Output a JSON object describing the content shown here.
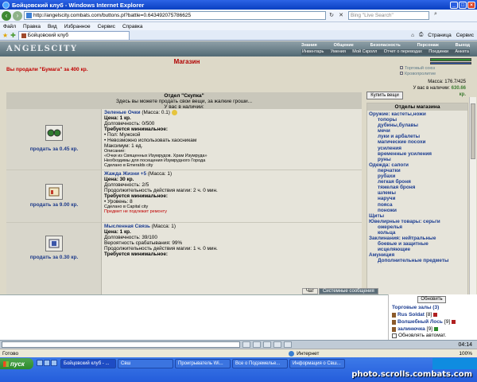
{
  "window": {
    "title": "Бойцовский клуб - Windows Internet Explorer",
    "address": "http://angelscity.combats.com/buttons.pl?battle=0.643492075786625",
    "search_placeholder": "Bing \"Live Search\""
  },
  "menu": [
    "Файл",
    "Правка",
    "Вид",
    "Избранное",
    "Сервис",
    "Справка"
  ],
  "tab_title": "Бойцовский клуб",
  "toolbar": {
    "page": "Страница",
    "service": "Сервис"
  },
  "site": {
    "logo": "ANGELSCITY",
    "nav_top": [
      "Знания",
      "Общение",
      "Безопасность",
      "Персонаж",
      "Выход"
    ],
    "nav_bottom": [
      "Инвентарь",
      "Умения",
      "Мой Скролл",
      "Отчет о переводах",
      "Поединки",
      "Анкета"
    ]
  },
  "shop": {
    "title": "Магазин",
    "sold_message": "Вы продали \"Бумага\" за 400 кр.",
    "effects": [
      "Торговый союз",
      "Кровопролитие"
    ],
    "mass": "Масса: 176.7/425",
    "money_label": "У вас в наличии:",
    "money_value": "630.66 кр.",
    "panel": {
      "title": "Отдел \"Скупка\"",
      "subtitle": "Здесь вы можете продать свои вещи, за жалкие гроши...",
      "in_stock": "У вас в наличии:"
    },
    "items": [
      {
        "sell": "продать за 0.45 кр.",
        "name": "Зеленые Очки",
        "mass": "(Масса: 0.1)",
        "price": "Цена: 1 кр.",
        "durability": "Долговечность: 0/500",
        "req_title": "Требуется минимальное:",
        "reqs": [
          "• Пол: Мужской",
          "• Невозможно использовать хаосникам"
        ],
        "extra": "Максимум: 1 ед.",
        "desc_title": "Описание:",
        "desc": "«Очки из Священных Изумрудов. Храм Изумруда»",
        "note": "Необходимы для посещения Изумрудного Города",
        "made": "Сделано в Emeralds city",
        "warn": ""
      },
      {
        "sell": "продать за 9.00 кр.",
        "name": "Жажда Жизни +5",
        "mass": "(Масса: 1)",
        "price": "Цена: 30 кр.",
        "durability": "Долговечность: 2/5",
        "extra": "Продолжительность действия магии: 2 ч. 0 мин.",
        "req_title": "Требуется минимальное:",
        "reqs": [
          "• Уровень: 8"
        ],
        "made": "Сделано в Capital city",
        "warn": "Предмет не подлежит ремонту"
      },
      {
        "sell": "продать за 0.30 кр.",
        "name": "Мысленная Связь",
        "mass": "(Масса: 1)",
        "price": "Цена: 1 кр.",
        "durability": "Долговечность: 39/100",
        "prob": "Вероятность срабатывания: 99%",
        "extra": "Продолжительность действия магии: 1 ч. 0 мин.",
        "req_title": "Требуется минимальное:"
      }
    ],
    "buy_button": "Купить вещи",
    "categories_title": "Отделы магазина",
    "categories": [
      {
        "label": "Оружие: кастеты,ножи",
        "type": "group"
      },
      {
        "label": "топоры",
        "type": "sub"
      },
      {
        "label": "дубины,булавы",
        "type": "sub"
      },
      {
        "label": "мечи",
        "type": "sub"
      },
      {
        "label": "луки и арбалеты",
        "type": "sub"
      },
      {
        "label": "магические посохи",
        "type": "sub"
      },
      {
        "label": "усиления",
        "type": "sub"
      },
      {
        "label": "временные усиления",
        "type": "sub"
      },
      {
        "label": "руны",
        "type": "sub"
      },
      {
        "label": "Одежда: сапоги",
        "type": "group"
      },
      {
        "label": "перчатки",
        "type": "sub"
      },
      {
        "label": "рубахи",
        "type": "sub"
      },
      {
        "label": "легкая броня",
        "type": "sub"
      },
      {
        "label": "тяжелая броня",
        "type": "sub"
      },
      {
        "label": "шлемы",
        "type": "sub"
      },
      {
        "label": "наручи",
        "type": "sub"
      },
      {
        "label": "пояса",
        "type": "sub"
      },
      {
        "label": "поножи",
        "type": "sub"
      },
      {
        "label": "Щиты",
        "type": "group"
      },
      {
        "label": "Ювелирные товары: серьги",
        "type": "group"
      },
      {
        "label": "ожерелья",
        "type": "sub"
      },
      {
        "label": "кольца",
        "type": "sub"
      },
      {
        "label": "Заклинания: нейтральные",
        "type": "group"
      },
      {
        "label": "боевые и защитные",
        "type": "sub"
      },
      {
        "label": "исцеляющие",
        "type": "sub"
      },
      {
        "label": "Амуниция",
        "type": "group"
      },
      {
        "label": "Дополнительные предметы",
        "type": "sub"
      }
    ]
  },
  "chat": {
    "tab_chat": "Чат",
    "tab_system": "Системные сообщения",
    "refresh_button": "Обновить",
    "room_title": "Торговые залы (3)",
    "players": [
      {
        "name": "Rus Soldat",
        "level": "[8]"
      },
      {
        "name": "Волшебный Лось",
        "level": "[9]"
      },
      {
        "name": "залинючка",
        "level": "[9]"
      }
    ],
    "auto_refresh": "Обновлять автомат.",
    "clock": "04:14"
  },
  "status": {
    "left": "Готово",
    "zone": "Интернет",
    "zoom": "100%"
  },
  "taskbar": {
    "start": "пуск",
    "tasks": [
      "Бойцовский клуб - ...",
      "Свш",
      "Проигрыватель Wi...",
      "Все о Подземелье...",
      "Информация о Свш..."
    ],
    "watermark": "photo.scrolls.combats.com"
  }
}
